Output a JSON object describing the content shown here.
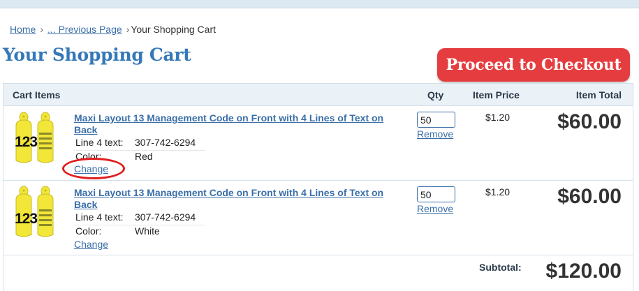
{
  "breadcrumb": {
    "home": "Home",
    "sep1": "›",
    "previous": "... Previous Page",
    "sep2": "›",
    "current": "Your Shopping Cart"
  },
  "page_title": "Your Shopping Cart",
  "checkout_button": "Proceed to Checkout",
  "table_headers": {
    "items": "Cart Items",
    "qty": "Qty",
    "price": "Item Price",
    "total": "Item Total"
  },
  "items": [
    {
      "title": "Maxi Layout 13 Management Code on Front with 4 Lines of Text on Back",
      "options": [
        {
          "label": "Line 4 text:",
          "value": "307-742-6294"
        },
        {
          "label": "Color:",
          "value": "Red"
        }
      ],
      "change": "Change",
      "qty": "50",
      "remove": "Remove",
      "price": "$1.20",
      "total": "$60.00",
      "tag_number": "123"
    },
    {
      "title": "Maxi Layout 13 Management Code on Front with 4 Lines of Text on Back",
      "options": [
        {
          "label": "Line 4 text:",
          "value": "307-742-6294"
        },
        {
          "label": "Color:",
          "value": "White"
        }
      ],
      "change": "Change",
      "qty": "50",
      "remove": "Remove",
      "price": "$1.20",
      "total": "$60.00",
      "tag_number": "123"
    }
  ],
  "subtotal_label": "Subtotal:",
  "subtotal_value": "$120.00",
  "colors": {
    "link": "#3a6fa8",
    "title": "#3578b8",
    "checkout": "#e53d3f",
    "tag": "#f2e639",
    "highlight": "#e11d1d"
  }
}
